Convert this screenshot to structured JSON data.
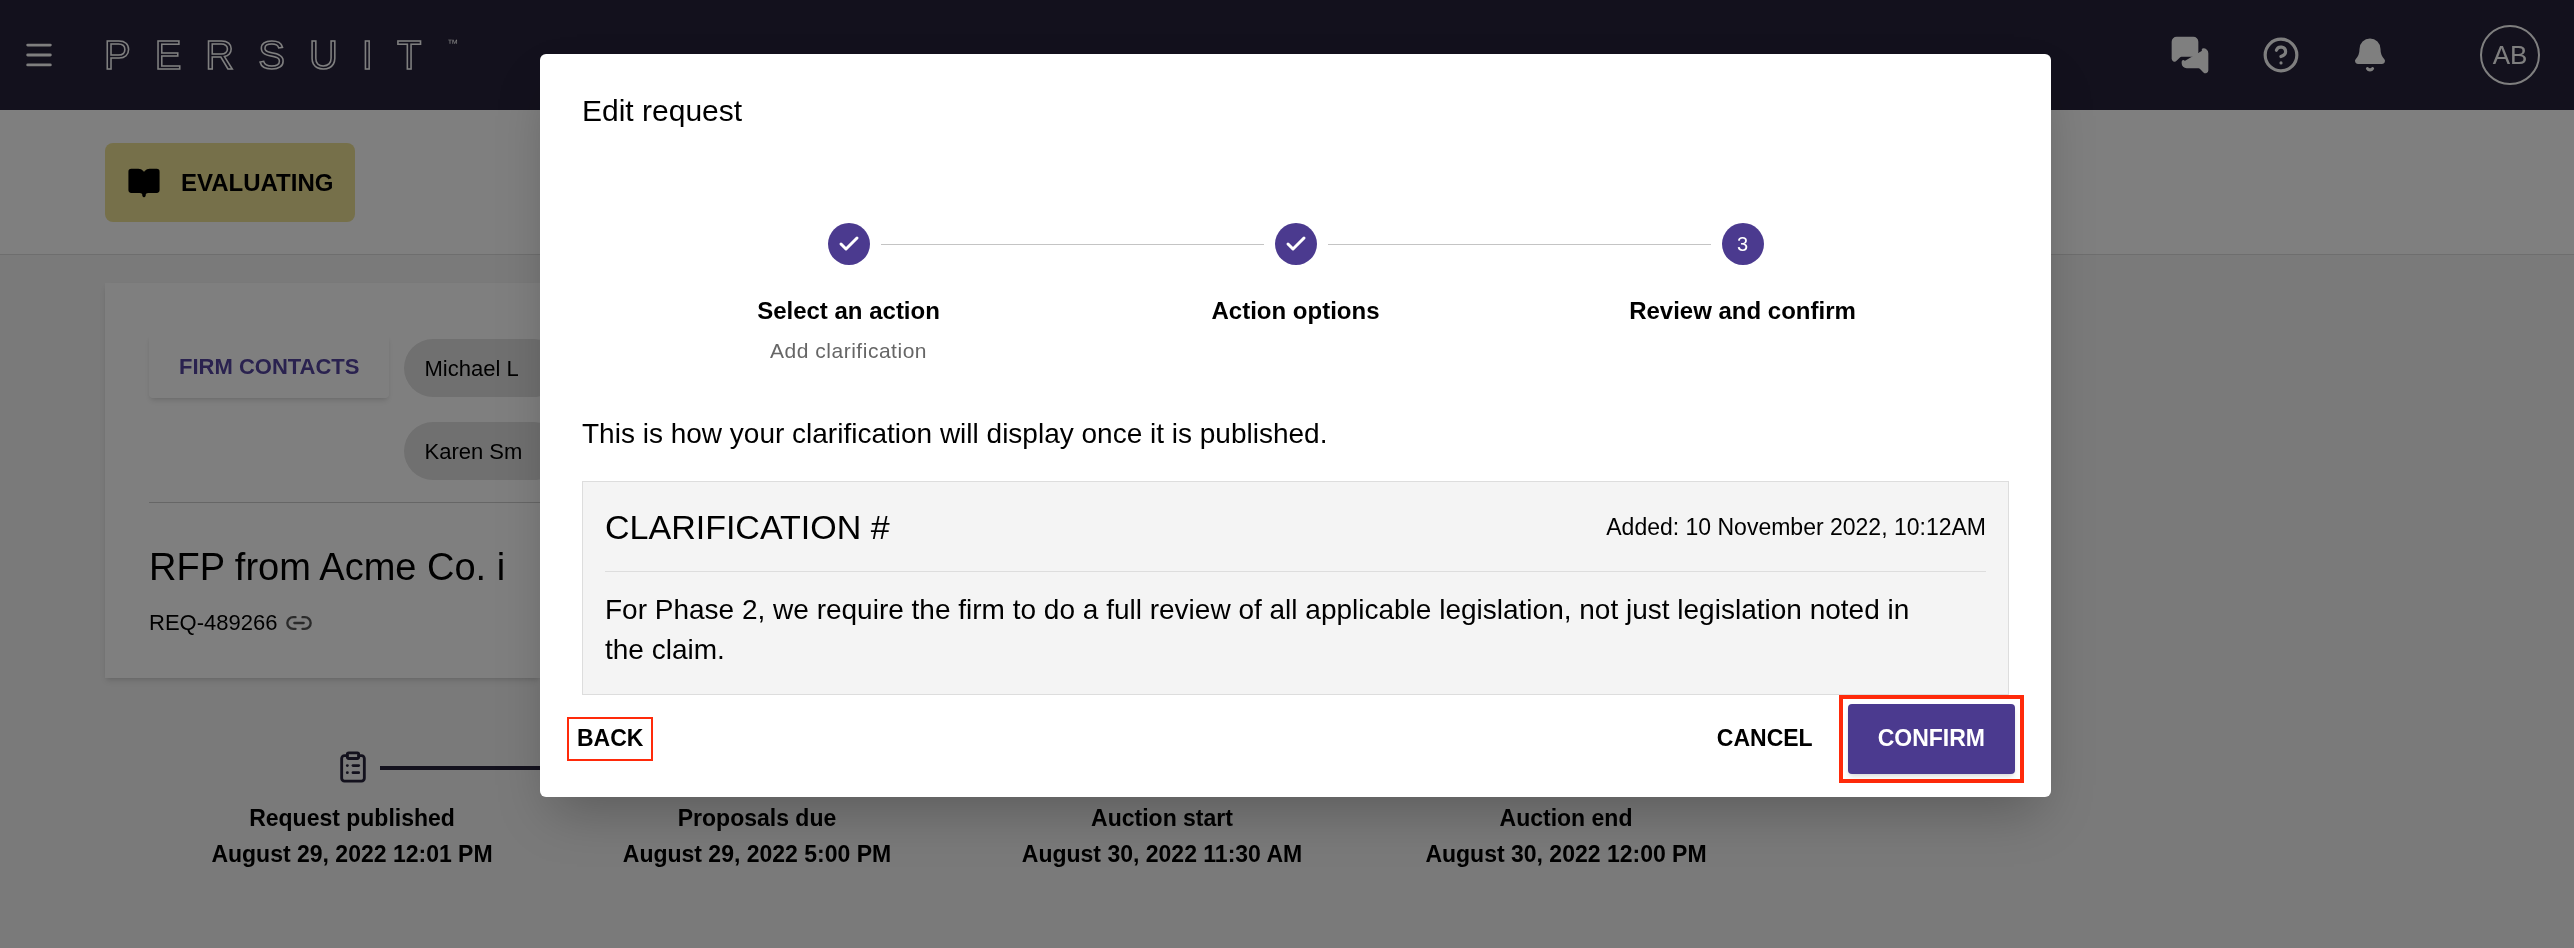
{
  "top_bar": {
    "logo": "PERSUIT",
    "trademark": "™",
    "avatar": "AB"
  },
  "status_chip": {
    "label": "EVALUATING"
  },
  "request_card": {
    "contacts_button": "FIRM CONTACTS",
    "contacts": [
      "Michael L",
      "Karen Sm"
    ],
    "title": "RFP from Acme Co. i",
    "request_id": "REQ-489266"
  },
  "timeline": [
    {
      "label": "Request published",
      "date": "August 29, 2022 12:01 PM"
    },
    {
      "label": "Proposals due",
      "date": "August 29, 2022 5:00 PM"
    },
    {
      "label": "Auction start",
      "date": "August 30, 2022 11:30 AM"
    },
    {
      "label": "Auction end",
      "date": "August 30, 2022 12:00 PM"
    }
  ],
  "dialog": {
    "title": "Edit request",
    "steps": [
      {
        "label": "Select an action",
        "sublabel": "Add clarification",
        "completed": true
      },
      {
        "label": "Action options",
        "completed": true
      },
      {
        "label": "Review and confirm",
        "number": "3",
        "completed": false
      }
    ],
    "intro": "This is how your clarification will display once it is published.",
    "preview": {
      "title": "CLARIFICATION #",
      "added": "Added: 10 November 2022, 10:12AM",
      "body": "For Phase 2, we require the firm to do a full review of all applicable legislation, not just legislation noted in the claim."
    },
    "buttons": [
      {
        "label": "BACK",
        "kind": "text",
        "highlighted": true
      },
      {
        "label": "CANCEL",
        "kind": "text",
        "highlighted": false
      },
      {
        "label": "CONFIRM",
        "kind": "contained",
        "highlighted": true
      }
    ]
  }
}
